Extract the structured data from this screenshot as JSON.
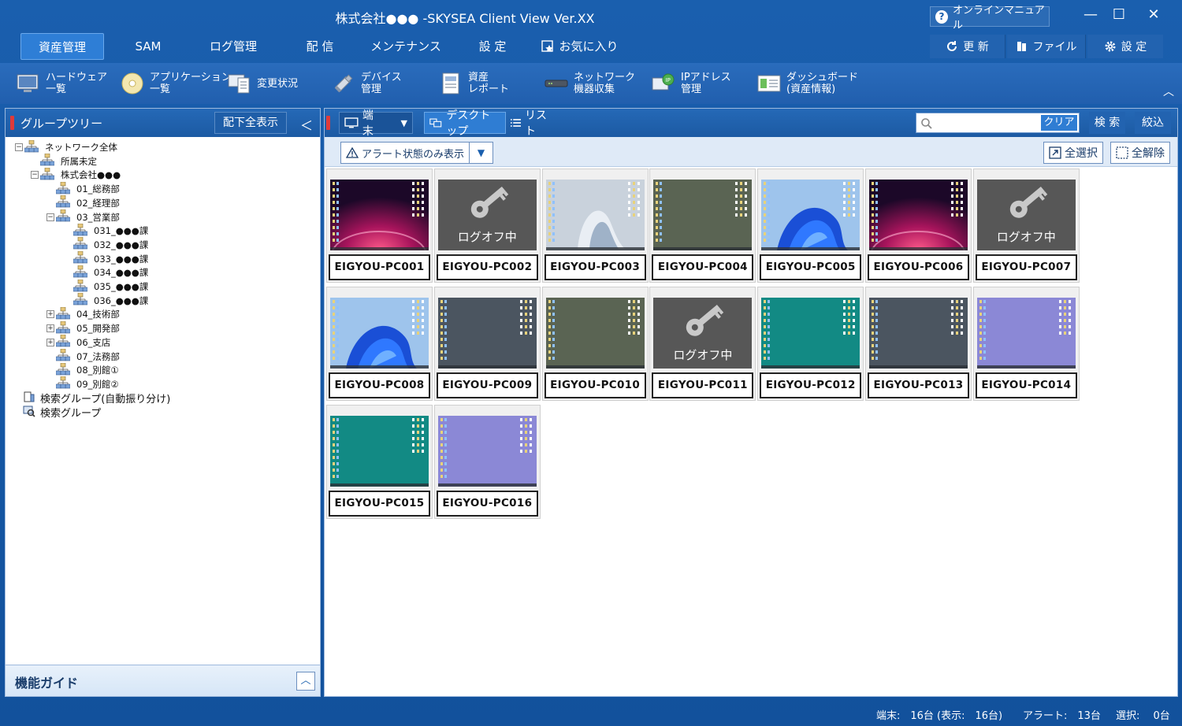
{
  "window": {
    "title": "株式会社●●● -SKYSEA Client View  Ver.XX",
    "manual_label": "オンラインマニュアル",
    "minimize": "—",
    "maximize": "☐",
    "close": "✕"
  },
  "menu": {
    "tabs": [
      "資産管理",
      "SAM",
      "ログ管理",
      "配 信",
      "メンテナンス",
      "設 定",
      "お気に入り"
    ],
    "refresh_label": "更 新",
    "file_label": "ファイル",
    "settings_label": "設 定"
  },
  "ribbon": {
    "items": [
      {
        "line1": "ハードウェア",
        "line2": "一覧",
        "icon": "monitor-icon"
      },
      {
        "line1": "アプリケーション",
        "line2": "一覧",
        "icon": "disc-icon"
      },
      {
        "line1": "変更状況",
        "line2": "",
        "icon": "document-monitor-icon"
      },
      {
        "line1": "デバイス",
        "line2": "管理",
        "icon": "usb-icon"
      },
      {
        "line1": "資産",
        "line2": "レポート",
        "icon": "report-icon"
      },
      {
        "line1": "ネットワーク",
        "line2": "機器収集",
        "icon": "network-device-icon"
      },
      {
        "line1": "IPアドレス",
        "line2": "管理",
        "icon": "ip-address-icon"
      },
      {
        "line1": "ダッシュボード",
        "line2": "(資産情報)",
        "icon": "dashboard-icon"
      }
    ],
    "collapse_glyph": "︿"
  },
  "left_panel": {
    "title": "グループツリー",
    "expand_all_label": "配下全表示",
    "collapse_glyph": "＜",
    "tree": [
      {
        "label": "ネットワーク全体",
        "level": 0,
        "expander": "−"
      },
      {
        "label": "所属未定",
        "level": 1,
        "expander": ""
      },
      {
        "label": "株式会社●●●",
        "level": 1,
        "expander": "−"
      },
      {
        "label": "01_総務部",
        "level": 2,
        "expander": ""
      },
      {
        "label": "02_経理部",
        "level": 2,
        "expander": ""
      },
      {
        "label": "03_営業部",
        "level": 2,
        "expander": "−"
      },
      {
        "label": "031_●●●課",
        "level": 3,
        "expander": ""
      },
      {
        "label": "032_●●●課",
        "level": 3,
        "expander": ""
      },
      {
        "label": "033_●●●課",
        "level": 3,
        "expander": ""
      },
      {
        "label": "034_●●●課",
        "level": 3,
        "expander": ""
      },
      {
        "label": "035_●●●課",
        "level": 3,
        "expander": ""
      },
      {
        "label": "036_●●●課",
        "level": 3,
        "expander": ""
      },
      {
        "label": "04_技術部",
        "level": 2,
        "expander": "+"
      },
      {
        "label": "05_開発部",
        "level": 2,
        "expander": "+"
      },
      {
        "label": "06_支店",
        "level": 2,
        "expander": "+"
      },
      {
        "label": "07_法務部",
        "level": 2,
        "expander": ""
      },
      {
        "label": "08_別館①",
        "level": 2,
        "expander": ""
      },
      {
        "label": "09_別館②",
        "level": 2,
        "expander": ""
      }
    ],
    "search_groups": [
      {
        "label": "検索グループ(自動振り分け)",
        "icon": "auto-search-group-icon"
      },
      {
        "label": "検索グループ",
        "icon": "search-group-icon"
      }
    ],
    "guide_label": "機能ガイド",
    "guide_glyph": "︿"
  },
  "right_panel": {
    "terminal_label": "端末",
    "desktop_label": "デスクトップ",
    "list_label": "リスト",
    "search_placeholder": "",
    "clear_label": "クリア",
    "search_label": "検 索",
    "filter_label": "絞込",
    "alert_only_label": "アラート状態のみ表示",
    "select_all_label": "全選択",
    "deselect_all_label": "全解除"
  },
  "pcs": [
    {
      "name": "EIGYOU-PC001",
      "screen": "magenta",
      "status": ""
    },
    {
      "name": "EIGYOU-PC002",
      "screen": "logoff",
      "status": "ログオフ中"
    },
    {
      "name": "EIGYOU-PC003",
      "screen": "white-bloom",
      "status": ""
    },
    {
      "name": "EIGYOU-PC004",
      "screen": "olive",
      "status": ""
    },
    {
      "name": "EIGYOU-PC005",
      "screen": "blue-bloom",
      "status": ""
    },
    {
      "name": "EIGYOU-PC006",
      "screen": "magenta",
      "status": ""
    },
    {
      "name": "EIGYOU-PC007",
      "screen": "logoff",
      "status": "ログオフ中"
    },
    {
      "name": "EIGYOU-PC008",
      "screen": "blue-bloom",
      "status": ""
    },
    {
      "name": "EIGYOU-PC009",
      "screen": "slate",
      "status": ""
    },
    {
      "name": "EIGYOU-PC010",
      "screen": "olive",
      "status": ""
    },
    {
      "name": "EIGYOU-PC011",
      "screen": "logoff",
      "status": "ログオフ中"
    },
    {
      "name": "EIGYOU-PC012",
      "screen": "teal",
      "status": ""
    },
    {
      "name": "EIGYOU-PC013",
      "screen": "slate",
      "status": ""
    },
    {
      "name": "EIGYOU-PC014",
      "screen": "lavender",
      "status": ""
    },
    {
      "name": "EIGYOU-PC015",
      "screen": "teal",
      "status": ""
    },
    {
      "name": "EIGYOU-PC016",
      "screen": "lavender",
      "status": ""
    }
  ],
  "status_bar": {
    "terminals": "端末:　16台 (表示:　16台)",
    "alerts": "アラート:　13台",
    "selected": "選択:　 0台"
  },
  "colors": {
    "accent": "#1a5fae",
    "active_tab": "#2e7ed6",
    "red_marker": "#e03a3a"
  }
}
